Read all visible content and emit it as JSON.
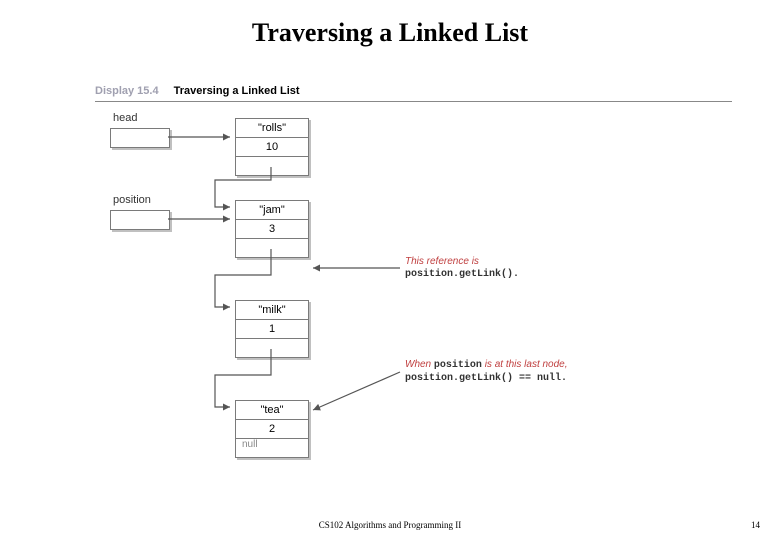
{
  "title": "Traversing a Linked List",
  "display": {
    "number": "Display 15.4",
    "caption": "Traversing a Linked List"
  },
  "pointers": {
    "head": {
      "label": "head"
    },
    "position": {
      "label": "position"
    }
  },
  "nodes": [
    {
      "item": "\"rolls\"",
      "count": "10",
      "link": ""
    },
    {
      "item": "\"jam\"",
      "count": "3",
      "link": ""
    },
    {
      "item": "\"milk\"",
      "count": "1",
      "link": ""
    },
    {
      "item": "\"tea\"",
      "count": "2",
      "link": "null"
    }
  ],
  "annotations": {
    "getlink": {
      "line1": "This reference is",
      "code": "position.getLink()."
    },
    "lastnode": {
      "line1_a": "When ",
      "line1_code": "position",
      "line1_b": " is at this last node,",
      "code": "position.getLink() == null."
    }
  },
  "footer": {
    "course": "CS102 Algorithms and Programming II",
    "page": "14"
  }
}
